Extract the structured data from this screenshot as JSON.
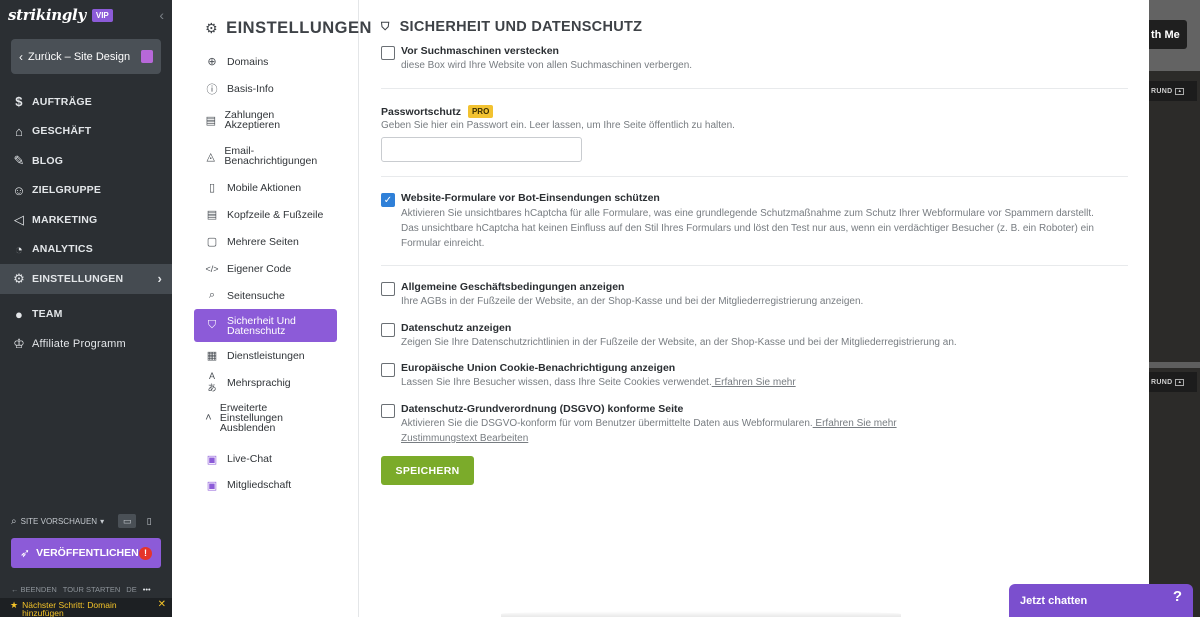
{
  "sidebar": {
    "logo": "strikingly",
    "vip_badge": "VIP",
    "back_button": "Zurück – Site Design",
    "nav": [
      {
        "label": "AUFTRÄGE",
        "icon": "dollar-circle-icon"
      },
      {
        "label": "GESCHÄFT",
        "icon": "store-icon"
      },
      {
        "label": "BLOG",
        "icon": "pen-icon"
      },
      {
        "label": "ZIELGRUPPE",
        "icon": "users-icon"
      },
      {
        "label": "MARKETING",
        "icon": "megaphone-icon"
      },
      {
        "label": "ANALYTICS",
        "icon": "chart-icon"
      },
      {
        "label": "EINSTELLUNGEN",
        "icon": "gear-icon"
      }
    ],
    "team": "TEAM",
    "affiliate": "Affiliate Programm",
    "site_preview": "SITE VORSCHAUEN",
    "publish": "VERÖFFENTLICHEN",
    "publish_alert": "!",
    "footer": {
      "end": "BEENDEN",
      "tour": "TOUR STARTEN",
      "lang": "DE",
      "more": "•••"
    },
    "next_step": "Nächster Schritt: Domain hinzufügen"
  },
  "settings_menu": {
    "title": "EINSTELLUNGEN",
    "items": [
      {
        "label": "Domains",
        "icon": "globe-icon"
      },
      {
        "label": "Basis-Info",
        "icon": "info-icon"
      },
      {
        "label": "Zahlungen Akzeptieren",
        "icon": "credit-card-icon"
      },
      {
        "label": "Email-Benachrichtigungen",
        "icon": "bell-icon"
      },
      {
        "label": "Mobile Aktionen",
        "icon": "mobile-icon"
      },
      {
        "label": "Kopfzeile & Fußzeile",
        "icon": "layout-icon"
      },
      {
        "label": "Mehrere Seiten",
        "icon": "pages-icon"
      },
      {
        "label": "Eigener Code",
        "icon": "code-icon"
      },
      {
        "label": "Seitensuche",
        "icon": "search-icon"
      },
      {
        "label": "Sicherheit Und Datenschutz",
        "icon": "shield-icon"
      },
      {
        "label": "Dienstleistungen",
        "icon": "grid-icon"
      },
      {
        "label": "Mehrsprachig",
        "icon": "translate-icon"
      },
      {
        "label": "Erweiterte Einstellungen Ausblenden",
        "icon": "chevron-up-icon"
      },
      {
        "label": "Live-Chat",
        "icon": "chat-icon"
      },
      {
        "label": "Mitgliedschaft",
        "icon": "member-icon"
      }
    ]
  },
  "security": {
    "title": "SICHERHEIT UND DATENSCHUTZ",
    "hide_search": {
      "label": "Vor Suchmaschinen verstecken",
      "desc": "diese Box wird Ihre Website von allen Suchmaschinen verbergen.",
      "checked": false
    },
    "password": {
      "label": "Passwortschutz",
      "badge": "PRO",
      "hint": "Geben Sie hier ein Passwort ein. Leer lassen, um Ihre Seite öffentlich zu halten.",
      "value": ""
    },
    "bot_protect": {
      "label": "Website-Formulare vor Bot-Einsendungen schützen",
      "desc": "Aktivieren Sie unsichtbares hCaptcha für alle Formulare, was eine grundlegende Schutzmaßnahme zum Schutz Ihrer Webformulare vor Spammern darstellt. Das unsichtbare hCaptcha hat keinen Einfluss auf den Stil Ihres Formulars und löst den Test nur aus, wenn ein verdächtiger Besucher (z. B. ein Roboter) ein Formular einreicht.",
      "checked": true
    },
    "terms": {
      "label": "Allgemeine Geschäftsbedingungen anzeigen",
      "desc": "Ihre AGBs in der Fußzeile der Website, an der Shop-Kasse und bei der Mitgliederregistrierung anzeigen.",
      "checked": false
    },
    "privacy": {
      "label": "Datenschutz anzeigen",
      "desc": "Zeigen Sie Ihre Datenschutzrichtlinien in der Fußzeile der Website, an der Shop-Kasse und bei der Mitgliederregistrierung an.",
      "checked": false
    },
    "cookie": {
      "label": "Europäische Union Cookie-Benachrichtigung anzeigen",
      "desc": "Lassen Sie Ihre Besucher wissen, dass Ihre Seite Cookies verwendet.",
      "link": " Erfahren Sie mehr",
      "checked": false
    },
    "gdpr": {
      "label": "Datenschutz-Grundverordnung (DSGVO) konforme Seite",
      "desc": "Aktivieren Sie die DSGVO-konform für vom Benutzer übermittelte Daten aus Webformularen.",
      "link": " Erfahren Sie mehr",
      "link2": "Zustimmungstext Bearbeiten",
      "checked": false
    },
    "save": "SPEICHERN"
  },
  "preview": {
    "button": "th Me",
    "tag1": "RUND",
    "tag2": "RUND"
  },
  "chat": {
    "label": "Jetzt chatten",
    "help": "?"
  },
  "colors": {
    "accent": "#8c5bd8",
    "save": "#7bab2a",
    "checkbox": "#2f80d8",
    "pro": "#f2c230"
  }
}
